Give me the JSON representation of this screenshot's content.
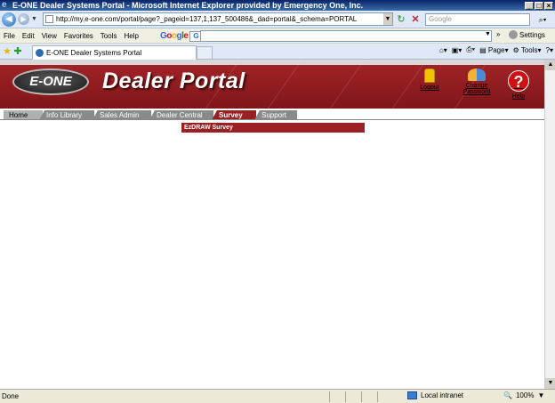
{
  "window": {
    "title": "E-ONE Dealer Systems Portal - Microsoft Internet Explorer provided by Emergency One, Inc."
  },
  "address": {
    "url": "http://my.e-one.com/portal/page?_pageid=137,1,137_500486&_dad=portal&_schema=PORTAL",
    "search_placeholder": "Google"
  },
  "menu": {
    "items": [
      "File",
      "Edit",
      "View",
      "Favorites",
      "Tools",
      "Help"
    ],
    "google_label": "Google",
    "more_label": "»",
    "settings_label": "Settings"
  },
  "browser_tab": {
    "label": "E-ONE Dealer Systems Portal"
  },
  "command_bar": {
    "page_label": "Page",
    "tools_label": "Tools"
  },
  "portal": {
    "logo_text": "E-ONE",
    "title": "Dealer Portal",
    "logout_label": "Logout",
    "change_password_line1": "Change",
    "change_password_line2": "Password",
    "help_label": "Help",
    "tabs": [
      "Home",
      "Info Library",
      "Sales Admin",
      "Dealer Central",
      "Survey",
      "Support"
    ],
    "active_tab": "Survey",
    "subtab_label": "EzDRAW Survey"
  },
  "status": {
    "text": "Done",
    "zone": "Local intranet",
    "zoom": "100%"
  },
  "colors": {
    "brand_red": "#9a2024",
    "tab_grey": "#8a8a8a"
  }
}
